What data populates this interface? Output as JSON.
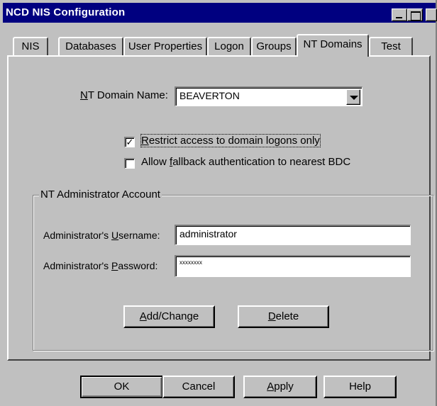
{
  "window": {
    "title": "NCD NIS Configuration"
  },
  "tabs": [
    {
      "label": "NIS"
    },
    {
      "label": "Databases"
    },
    {
      "label": "User Properties"
    },
    {
      "label": "Logon"
    },
    {
      "label": "Groups"
    },
    {
      "label": "NT Domains",
      "active": true
    },
    {
      "label": "Test"
    }
  ],
  "nt_domains": {
    "domain_name_label_pre": "",
    "domain_name_label_accel": "N",
    "domain_name_label_post": "T Domain Name:",
    "domain_name_value": "BEAVERTON",
    "restrict": {
      "accel": "R",
      "rest": "estrict access to domain logons only",
      "checked": true,
      "mark": "✓"
    },
    "fallback": {
      "pre": "Allow ",
      "accel": "f",
      "rest": "allback authentication to nearest BDC",
      "checked": false
    },
    "admin_group": {
      "title": "NT Administrator Account",
      "username_label_pre": "Administrator's ",
      "username_label_accel": "U",
      "username_label_post": "sername:",
      "username_value": "administrator",
      "password_label_pre": "Administrator's ",
      "password_label_accel": "P",
      "password_label_post": "assword:",
      "password_value": "xxxxxxxx",
      "add_change_accel": "A",
      "add_change_rest": "dd/Change",
      "delete_accel": "D",
      "delete_rest": "elete"
    }
  },
  "footer": {
    "ok": "OK",
    "cancel": "Cancel",
    "apply_accel": "A",
    "apply_rest": "pply",
    "help": "Help"
  }
}
